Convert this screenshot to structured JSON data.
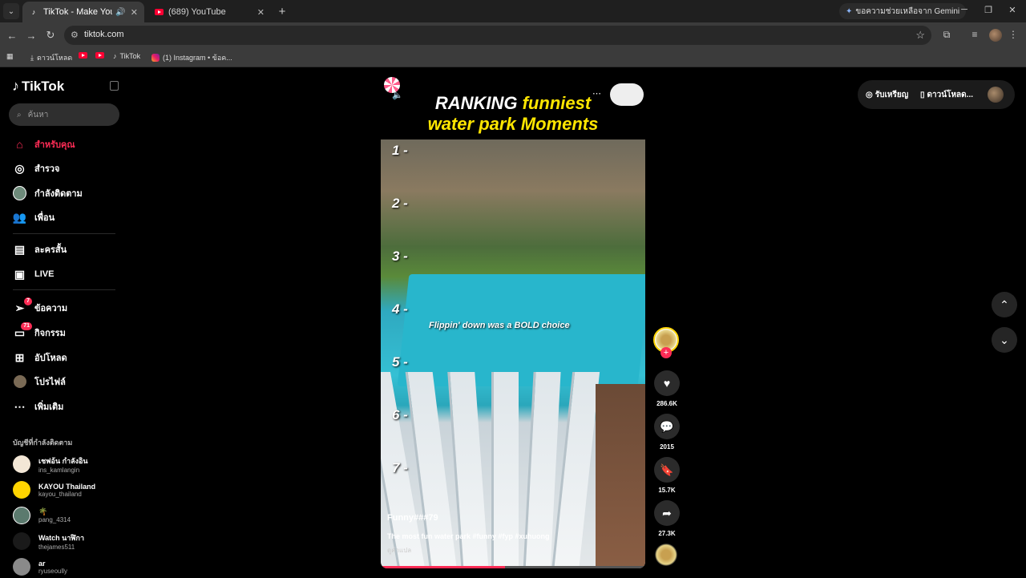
{
  "browser": {
    "tabs": [
      {
        "title": "TikTok - Make Your Day",
        "active": true
      },
      {
        "title": "(689) YouTube",
        "active": false
      }
    ],
    "gemini_label": "ขอความช่วยเหลือจาก Gemini",
    "url": "tiktok.com",
    "bookmarks": {
      "downloads": "ดาวน์โหลด",
      "tiktok": "TikTok",
      "instagram": "(1) Instagram • ข้อค..."
    }
  },
  "sidebar": {
    "logo_text": "TikTok",
    "search_placeholder": "ค้นหา",
    "nav": [
      {
        "label": "สำหรับคุณ",
        "icon": "home-icon"
      },
      {
        "label": "สำรวจ",
        "icon": "compass-icon"
      },
      {
        "label": "กำลังติดตาม",
        "icon": "following-icon"
      },
      {
        "label": "เพื่อน",
        "icon": "friends-icon"
      },
      {
        "label": "ละครสั้น",
        "icon": "drama-icon"
      },
      {
        "label": "LIVE",
        "icon": "live-icon"
      },
      {
        "label": "ข้อความ",
        "icon": "message-icon",
        "badge": "7"
      },
      {
        "label": "กิจกรรม",
        "icon": "activity-icon",
        "badge": "71"
      },
      {
        "label": "อัปโหลด",
        "icon": "upload-icon"
      },
      {
        "label": "โปรไฟล์",
        "icon": "profile-icon"
      },
      {
        "label": "เพิ่มเติม",
        "icon": "more-icon"
      }
    ],
    "following_title": "บัญชีที่กำลังติดตาม",
    "accounts": [
      {
        "name": "เชฟอ้น กำลังอิน",
        "handle": "ins_kamlangin"
      },
      {
        "name": "KAYOU Thailand",
        "handle": "kayou_thailand"
      },
      {
        "name": "🌴",
        "handle": "pang_4314"
      },
      {
        "name": "Watch นาฬิกา",
        "handle": "thejames511"
      },
      {
        "name": "ar",
        "handle": "ryuseoully"
      }
    ]
  },
  "video": {
    "title_line1_white": "RANKING ",
    "title_line1_yellow": "funniest",
    "title_line2": "water park Moments",
    "ranks": [
      "1 -",
      "2 -",
      "3 -",
      "4 -",
      "5 -",
      "6 -",
      "7 -"
    ],
    "overlay_caption": "Flippin' down was a BOLD choice",
    "author": "Funny###79",
    "caption": "The most fun water park #funny #fyp #xuhuong",
    "see_more": "ดูคำแปล",
    "progress": 0.47
  },
  "actions": {
    "likes": "286.6K",
    "comments": "2015",
    "saves": "15.7K",
    "shares": "27.3K"
  },
  "topright": {
    "coins_label": "รับเหรียญ",
    "download_label": "ดาวน์โหลด..."
  },
  "colors": {
    "accent": "#fe2c55",
    "title_yellow": "#ffe600"
  }
}
